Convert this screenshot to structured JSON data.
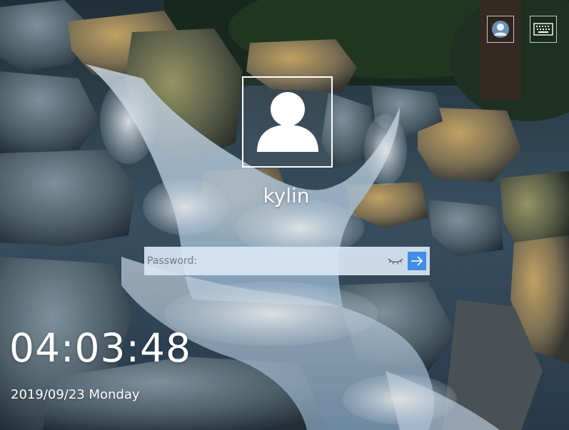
{
  "login": {
    "username": "kylin",
    "password_placeholder": "Password:"
  },
  "clock": {
    "time": "04:03:48",
    "date": "2019/09/23 Monday"
  },
  "icons": {
    "top_right": [
      "user-switch-icon",
      "keyboard-icon"
    ],
    "avatar": "user-silhouette-icon",
    "password": [
      "eye-closed-icon",
      "arrow-right-icon"
    ]
  },
  "colors": {
    "submit_button": "#3e8ee6",
    "password_field": "#d8e5f3",
    "text": "#ffffff"
  }
}
